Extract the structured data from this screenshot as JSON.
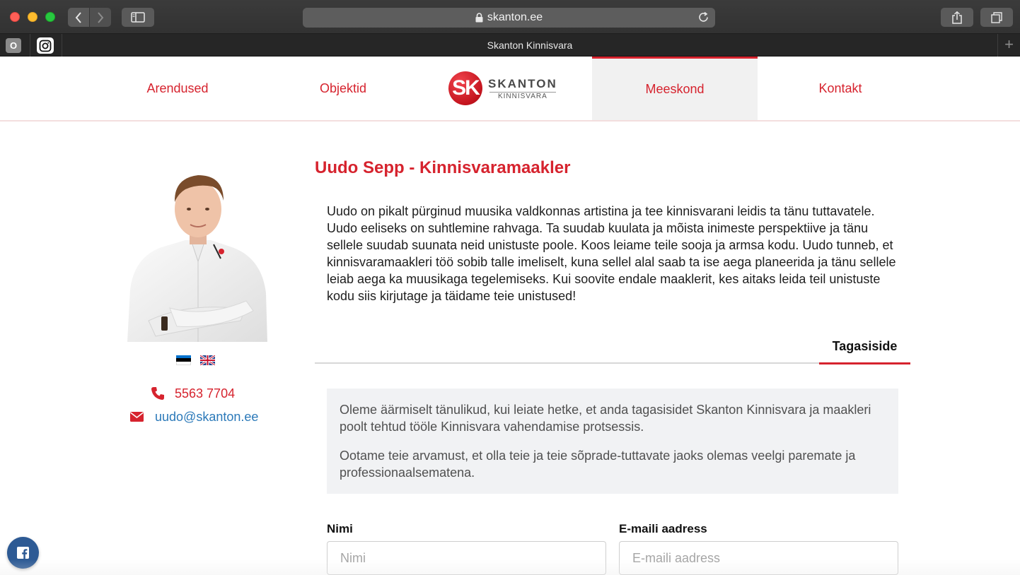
{
  "browser": {
    "url": "skanton.ee",
    "tab_title": "Skanton Kinnisvara",
    "fav1_letter": "O"
  },
  "nav": {
    "items": [
      {
        "label": "Arendused"
      },
      {
        "label": "Objektid"
      },
      {
        "label": "Meeskond",
        "active": true
      },
      {
        "label": "Kontakt"
      }
    ],
    "logo": {
      "mark": "SK",
      "name": "SKANTON",
      "sub": "KINNISVARA"
    }
  },
  "profile": {
    "title": "Uudo Sepp - Kinnisvaramaakler",
    "bio": "Uudo on pikalt pürginud muusika valdkonnas artistina ja tee kinnisvarani leidis ta tänu tuttavatele. Uudo eeliseks on suhtlemine rahvaga. Ta suudab kuulata ja mõista inimeste perspektiive ja tänu sellele suudab suunata neid unistuste poole. Koos leiame teile sooja ja armsa kodu. Uudo tunneb, et kinnisvaramaakleri töö sobib talle imeliselt, kuna sellel alal saab ta ise aega planeerida ja tänu sellele leiab aega ka muusikaga tegelemiseks. Kui soovite endale maaklerit, kes aitaks leida teil unistuste kodu siis kirjutage ja täidame teie unistused!",
    "phone": "5563 7704",
    "email": "uudo@skanton.ee"
  },
  "feedback": {
    "tab_label": "Tagasiside",
    "intro_1": "Oleme äärmiselt tänulikud, kui leiate hetke, et anda tagasisidet Skanton Kinnisvara ja maakleri poolt tehtud tööle Kinnisvara vahendamise protsessis.",
    "intro_2": "Ootame teie arvamust, et olla teie ja teie sõprade-tuttavate jaoks olemas veelgi paremate ja professionaalsematena.",
    "name_label": "Nimi",
    "name_placeholder": "Nimi",
    "email_label": "E-maili aadress",
    "email_placeholder": "E-maili aadress"
  },
  "colors": {
    "brand_red": "#d6232e",
    "link_blue": "#2b79b9",
    "facebook_blue": "#2d5a94"
  }
}
